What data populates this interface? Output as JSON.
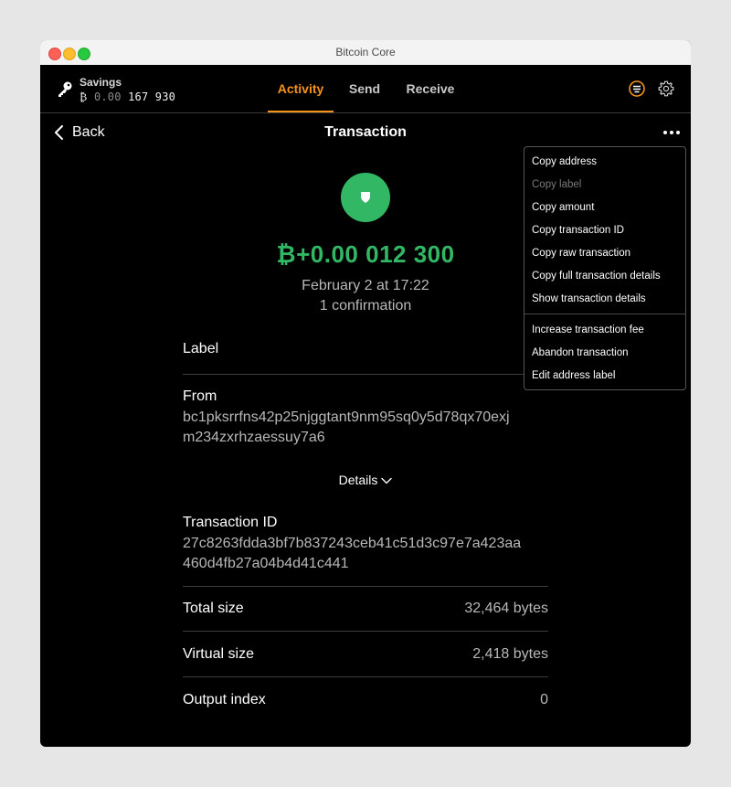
{
  "window": {
    "title": "Bitcoin Core"
  },
  "header": {
    "wallet_name": "Savings",
    "balance_symbol": "₿",
    "balance_dim": "0.00",
    "balance_main": "167 930",
    "tabs": [
      {
        "label": "Activity",
        "active": true
      },
      {
        "label": "Send",
        "active": false
      },
      {
        "label": "Receive",
        "active": false
      }
    ],
    "icons": {
      "network": "network-status-icon",
      "settings": "gear-icon"
    }
  },
  "nav": {
    "back_label": "Back",
    "title": "Transaction"
  },
  "transaction": {
    "amount": "₿+0.00 012 300",
    "date": "February 2 at 17:22",
    "confirmations": "1 confirmation",
    "label_title": "Label",
    "from_title": "From",
    "from_address_line1": "bc1pksrrfns42p25njggtant9nm95sq0y5d78qx70exj",
    "from_address_line2": "m234zxrhzaessuy7a6",
    "details_label": "Details",
    "txid_title": "Transaction ID",
    "txid_line1": "27c8263fdda3bf7b837243ceb41c51d3c97e7a423aa",
    "txid_line2": "460d4fb27a04b4d41c441",
    "total_size_label": "Total size",
    "total_size_value": "32,464 bytes",
    "virtual_size_label": "Virtual size",
    "virtual_size_value": "2,418 bytes",
    "output_index_label": "Output index",
    "output_index_value": "0"
  },
  "menu": {
    "items": [
      {
        "label": "Copy address",
        "enabled": true
      },
      {
        "label": "Copy label",
        "enabled": false
      },
      {
        "label": "Copy amount",
        "enabled": true
      },
      {
        "label": "Copy transaction ID",
        "enabled": true
      },
      {
        "label": "Copy raw transaction",
        "enabled": true
      },
      {
        "label": "Copy full transaction details",
        "enabled": true
      },
      {
        "label": "Show transaction details",
        "enabled": true
      },
      {
        "label": "Increase transaction fee",
        "enabled": true
      },
      {
        "label": "Abandon transaction",
        "enabled": true
      },
      {
        "label": "Edit address label",
        "enabled": true
      }
    ]
  },
  "colors": {
    "accent": "#f7931a",
    "positive": "#32b765",
    "background": "#000000"
  }
}
